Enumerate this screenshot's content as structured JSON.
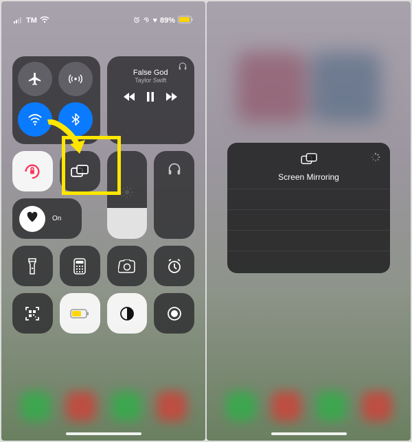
{
  "status": {
    "carrier": "TM",
    "wifi_glyph": "wifi-icon",
    "alarm_glyph": "alarm-icon",
    "battery_pct": "89%",
    "heart_glyph": "♥"
  },
  "connectivity": {
    "airplane": {
      "name": "airplane-mode",
      "on": false
    },
    "cellular": {
      "name": "cellular-data",
      "on": false
    },
    "wifi": {
      "name": "wifi",
      "on": true
    },
    "bluetooth": {
      "name": "bluetooth",
      "on": true
    }
  },
  "music": {
    "title": "False God",
    "artist": "Taylor Swift",
    "output_icon": "headphones-icon"
  },
  "controls_row1": {
    "orientation_lock": "orientation-lock",
    "screen_mirroring": "screen-mirroring",
    "brightness": "brightness",
    "volume": "volume"
  },
  "focus": {
    "icon": "heart-icon",
    "label": "On"
  },
  "utility_row": [
    {
      "name": "flashlight"
    },
    {
      "name": "calculator"
    },
    {
      "name": "camera"
    },
    {
      "name": "timer"
    }
  ],
  "utility_row2": [
    {
      "name": "qr-scan"
    },
    {
      "name": "low-power-mode"
    },
    {
      "name": "dark-mode"
    },
    {
      "name": "screen-record"
    }
  ],
  "mirror": {
    "title": "Screen Mirroring",
    "icon": "screen-mirroring-icon"
  },
  "colors": {
    "blue": "#0a7aff",
    "yellow": "#ffe600",
    "lowPower": "#ffd60a"
  }
}
